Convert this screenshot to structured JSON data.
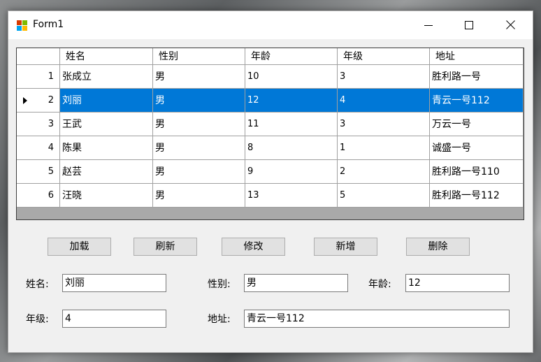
{
  "window": {
    "title": "Form1"
  },
  "grid": {
    "columns": [
      "姓名",
      "性别",
      "年龄",
      "年级",
      "地址"
    ],
    "rows": [
      {
        "index": "1",
        "name": "张成立",
        "gender": "男",
        "age": "10",
        "grade": "3",
        "address": "胜利路一号"
      },
      {
        "index": "2",
        "name": "刘丽",
        "gender": "男",
        "age": "12",
        "grade": "4",
        "address": "青云一号112"
      },
      {
        "index": "3",
        "name": "王武",
        "gender": "男",
        "age": "11",
        "grade": "3",
        "address": "万云一号"
      },
      {
        "index": "4",
        "name": "陈果",
        "gender": "男",
        "age": "8",
        "grade": "1",
        "address": "诚盛一号"
      },
      {
        "index": "5",
        "name": "赵芸",
        "gender": "男",
        "age": "9",
        "grade": "2",
        "address": "胜利路一号110"
      },
      {
        "index": "6",
        "name": "汪晓",
        "gender": "男",
        "age": "13",
        "grade": "5",
        "address": "胜利路一号112"
      }
    ],
    "selected_row": 2
  },
  "buttons": {
    "load": "加载",
    "refresh": "刷新",
    "edit": "修改",
    "add": "新增",
    "delete": "删除"
  },
  "form": {
    "name_label": "姓名:",
    "name_value": "刘丽",
    "gender_label": "性别:",
    "gender_value": "男",
    "age_label": "年龄:",
    "age_value": "12",
    "grade_label": "年级:",
    "grade_value": "4",
    "address_label": "地址:",
    "address_value": "青云一号112"
  },
  "colors": {
    "selection": "#0078d7",
    "grid_background": "#a9a9a9",
    "form_background": "#f0f0f0"
  },
  "icons": {
    "app": "winforms-app-icon",
    "minimize": "minimize-icon",
    "maximize": "maximize-icon",
    "close": "close-icon",
    "row_indicator": "current-row-arrow-icon"
  }
}
